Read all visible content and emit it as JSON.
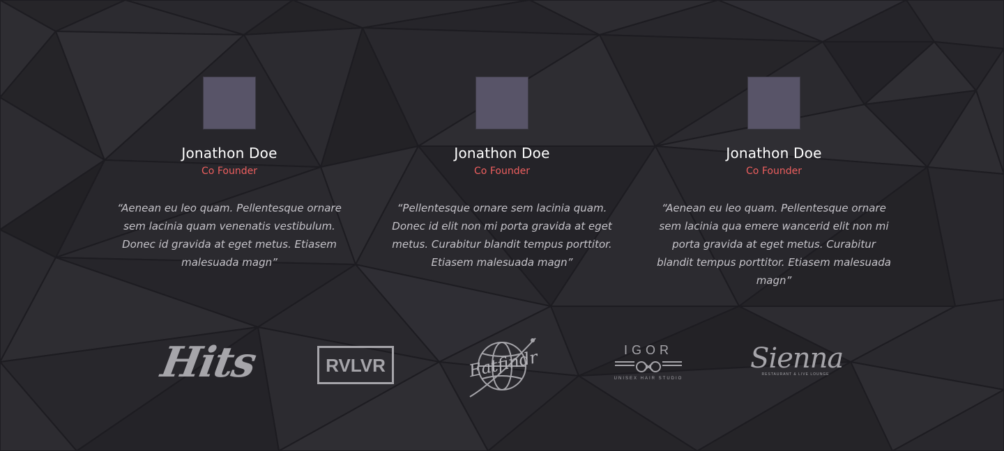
{
  "testimonials": [
    {
      "name": "Jonathon Doe",
      "role": "Co Founder",
      "quote": "“Aenean eu leo quam. Pellentesque ornare sem lacinia quam venenatis vestibulum. Donec id gravida at eget metus. Etiasem malesuada magn”"
    },
    {
      "name": "Jonathon Doe",
      "role": "Co Founder",
      "quote": "“Pellentesque ornare sem lacinia quam. Donec id elit non mi porta gravida at eget metus. Curabitur blandit tempus porttitor. Etiasem malesuada magn”"
    },
    {
      "name": "Jonathon Doe",
      "role": "Co Founder",
      "quote": "“Aenean eu leo quam. Pellentesque ornare sem lacinia qua emere wancerid elit non mi porta gravida at eget metus. Curabitur blandit tempus porttitor. Etiasem malesuada magn”"
    }
  ],
  "logos": {
    "hits": "Hits",
    "rvlvr": "RVLVR",
    "eatfindr": "Eatfindr",
    "igor": {
      "title": "IGOR",
      "subtitle": "UNISEX HAIR STUDIO"
    },
    "sienna": {
      "title": "Sienna",
      "subtitle": "RESTAURANT & LIVE LOUNGE"
    }
  },
  "colors": {
    "background": "#2a292e",
    "name_text": "#ffffff",
    "role_accent": "#ee5f5f",
    "quote_text": "#c6c4ca",
    "avatar_placeholder": "#585468",
    "logo_gray": "#a6a5aa"
  }
}
